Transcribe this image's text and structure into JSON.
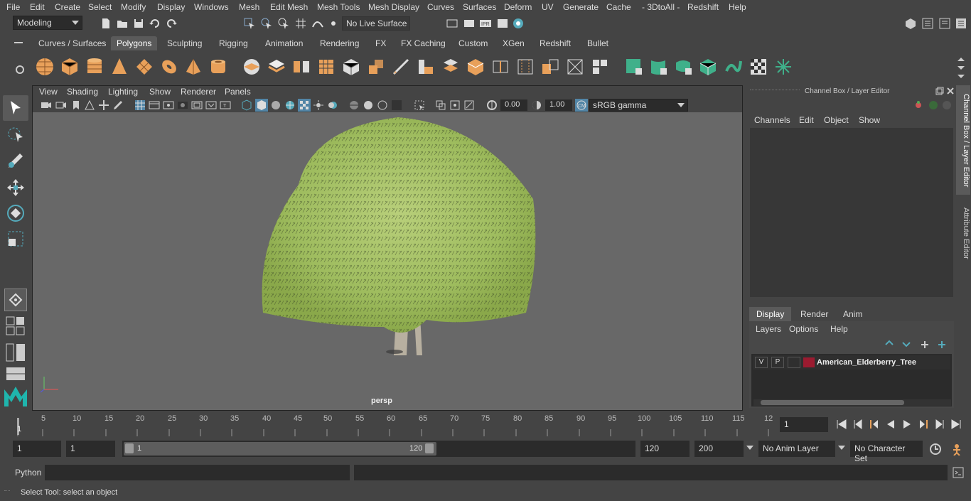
{
  "menubar": {
    "items": [
      "File",
      "Edit",
      "Create",
      "Select",
      "Modify",
      "Display",
      "Windows",
      "Mesh",
      "Edit Mesh",
      "Mesh Tools",
      "Mesh Display",
      "Curves",
      "Surfaces",
      "Deform",
      "UV",
      "Generate",
      "Cache",
      "- 3DtoAll -",
      "Redshift",
      "Help"
    ]
  },
  "statusline": {
    "mode_value": "Modeling",
    "live_surface": "No Live Surface"
  },
  "shelf": {
    "tabs": [
      "Curves / Surfaces",
      "Polygons",
      "Sculpting",
      "Rigging",
      "Animation",
      "Rendering",
      "FX",
      "FX Caching",
      "Custom",
      "XGen",
      "Redshift",
      "Bullet"
    ],
    "active_tab": "Polygons"
  },
  "viewport": {
    "menu": [
      "View",
      "Shading",
      "Lighting",
      "Show",
      "Renderer",
      "Panels"
    ],
    "exposure": "0.00",
    "gamma": "1.00",
    "color_space": "sRGB gamma",
    "camera_label": "persp"
  },
  "channel_box": {
    "title": "Channel Box / Layer Editor",
    "menu": [
      "Channels",
      "Edit",
      "Object",
      "Show"
    ]
  },
  "layer_editor": {
    "tabs": [
      "Display",
      "Render",
      "Anim"
    ],
    "active_tab": "Display",
    "menu": [
      "Layers",
      "Options",
      "Help"
    ],
    "layer": {
      "v": "V",
      "p": "P",
      "name": "American_Elderberry_Tree",
      "color": "#9b1b30"
    }
  },
  "side_tabs": [
    "Channel Box / Layer Editor",
    "Attribute Editor"
  ],
  "timeline": {
    "ticks": [
      "1",
      "5",
      "10",
      "15",
      "20",
      "25",
      "30",
      "35",
      "40",
      "45",
      "50",
      "55",
      "60",
      "65",
      "70",
      "75",
      "80",
      "85",
      "90",
      "95",
      "100",
      "105",
      "110",
      "115",
      "12"
    ],
    "current_frame": "1"
  },
  "range": {
    "start": "1",
    "playback_start": "1",
    "slider_start": "1",
    "slider_end": "120",
    "playback_end": "120",
    "end": "200",
    "anim_layer": "No Anim Layer",
    "character_set": "No Character Set"
  },
  "cmdline": {
    "label": "Python"
  },
  "helpline": {
    "text": "Select Tool: select an object"
  },
  "colors": {
    "accent": "#5285a6",
    "bg": "#444444",
    "viewport": "#686868",
    "icon_orange": "#e8a05a",
    "icon_teal": "#3fb08a"
  }
}
